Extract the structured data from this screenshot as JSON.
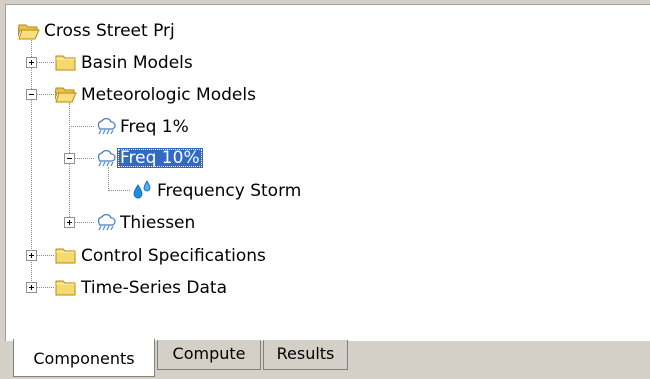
{
  "tree": {
    "root": {
      "label": "Cross Street Prj",
      "icon": "folder-open-icon"
    },
    "items": [
      {
        "label": "Basin Models",
        "icon": "folder-icon",
        "expander": "collapsed"
      },
      {
        "label": "Meteorologic Models",
        "icon": "folder-open-icon",
        "expander": "expanded",
        "children": [
          {
            "label": "Freq 1%",
            "icon": "rain-cloud-icon"
          },
          {
            "label": "Freq 10%",
            "icon": "rain-cloud-icon",
            "expander": "expanded",
            "selected": true,
            "children": [
              {
                "label": "Frequency Storm",
                "icon": "water-drops-icon"
              }
            ]
          },
          {
            "label": "Thiessen",
            "icon": "rain-cloud-icon",
            "expander": "collapsed"
          }
        ]
      },
      {
        "label": "Control Specifications",
        "icon": "folder-icon",
        "expander": "collapsed"
      },
      {
        "label": "Time-Series Data",
        "icon": "folder-icon",
        "expander": "collapsed"
      }
    ]
  },
  "tabs": [
    {
      "label": "Components",
      "active": true
    },
    {
      "label": "Compute",
      "active": false
    },
    {
      "label": "Results",
      "active": false
    }
  ],
  "colors": {
    "folder": "#f5d56b",
    "selection": "#316ac5",
    "cloud": "#5b8fd6",
    "drop": "#1e7fd6"
  }
}
